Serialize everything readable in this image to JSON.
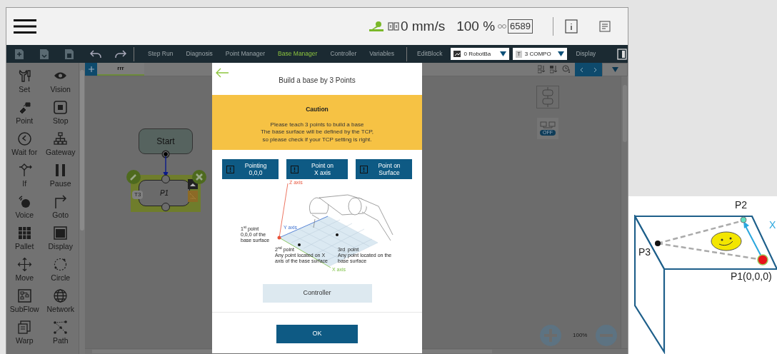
{
  "header": {
    "speed": "0 mm/s",
    "percent": "100 %",
    "counter": "6589"
  },
  "toolbar": {
    "menu": [
      {
        "label": "Step Run",
        "selected": false
      },
      {
        "label": "Diagnosis",
        "selected": false
      },
      {
        "label": "Point Manager",
        "selected": false
      },
      {
        "label": "Base Manager",
        "selected": true
      },
      {
        "label": "Controller",
        "selected": false
      },
      {
        "label": "Variables",
        "selected": false
      }
    ],
    "edit_block": "EditBlock",
    "base_dropdown": "0 RobotBa",
    "tool_dropdown": {
      "badge": "T",
      "value": "3 COMPO"
    },
    "display": "Display"
  },
  "palette": [
    {
      "label": "Set"
    },
    {
      "label": "Vision"
    },
    {
      "label": "Point"
    },
    {
      "label": "Stop"
    },
    {
      "label": "Wait for"
    },
    {
      "label": "Gateway"
    },
    {
      "label": "If"
    },
    {
      "label": "Pause"
    },
    {
      "label": "Voice"
    },
    {
      "label": "Goto"
    },
    {
      "label": "Pallet"
    },
    {
      "label": "Display"
    },
    {
      "label": "Move"
    },
    {
      "label": "Circle"
    },
    {
      "label": "SubFlow"
    },
    {
      "label": "Network"
    },
    {
      "label": "Warp"
    },
    {
      "label": "Path"
    }
  ],
  "canvas": {
    "tab": "rrr",
    "start_node": "Start",
    "point_node": {
      "label": "P1",
      "tag": "T3"
    },
    "toggle": "OFF",
    "zoom": "100%"
  },
  "dialog": {
    "title": "Build a base by 3 Points",
    "caution_title": "Caution",
    "caution_text": "Please teach 3 points to build a base\nThe base surface will be defined by the TCP,\nso please check if your TCP setting is right.",
    "point_buttons": [
      {
        "label": "Pointing\n0,0,0"
      },
      {
        "label": "Point on\nX axis"
      },
      {
        "label": "Point on\nSurface"
      }
    ],
    "figure_labels": [
      {
        "kind": "z",
        "text": "Z axis"
      },
      {
        "kind": "y",
        "text": "Y axis"
      },
      {
        "kind": "p1",
        "text": "1$^{st}$ point\n0,0,0 of the\nbase surface"
      },
      {
        "kind": "p2",
        "text": "2$^{nd}$ point\nAny point located on X\naxis of the base surface"
      },
      {
        "kind": "p3",
        "text": "3rd  point\nAny point located on the\nbase surface"
      },
      {
        "kind": "x",
        "text": "X axis"
      }
    ],
    "controller_button": "Controller",
    "ok_button": "OK"
  },
  "diagram": {
    "labels": [
      {
        "kind": "p2",
        "text": "P2"
      },
      {
        "kind": "p3",
        "text": "P3"
      },
      {
        "kind": "p1",
        "text": "P1(0,0,0)"
      },
      {
        "kind": "x",
        "text": "X"
      }
    ]
  }
}
